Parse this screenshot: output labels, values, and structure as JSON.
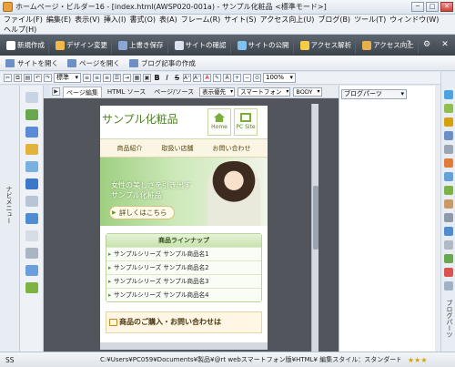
{
  "window": {
    "title": "ホームページ・ビルダー16 - [index.html(AWSP020-001a) - サンプル化粧品 <標準モード>]",
    "min": "─",
    "max": "□",
    "close": "✕"
  },
  "menu": {
    "row1": [
      "ファイル(F)",
      "編集(E)",
      "表示(V)",
      "挿入(I)",
      "書式(O)",
      "表(A)",
      "フレーム(R)",
      "サイト(S)",
      "アクセス向上(U)",
      "ブログ(B)",
      "ツール(T)",
      "ウィンドウ(W)"
    ],
    "row2": [
      "ヘルプ(H)"
    ]
  },
  "main_toolbar": [
    {
      "label": "新規作成",
      "color": "#ffffff"
    },
    {
      "label": "デザイン変更",
      "color": "#f2b84b"
    },
    {
      "label": "上書き保存",
      "color": "#8aa6d6"
    },
    {
      "label": "サイトの確認",
      "color": "#d9e2ee"
    },
    {
      "label": "サイトの公開",
      "color": "#7fc1ef"
    },
    {
      "label": "アクセス解析",
      "color": "#f4cc46"
    },
    {
      "label": "アクセス向上",
      "color": "#e8b04a"
    }
  ],
  "main_toolbar_right": [
    "?",
    "⚙",
    "✕"
  ],
  "sub_toolbar": [
    "サイトを開く",
    "ページを開く",
    "ブログ記事の作成"
  ],
  "format_toolbar": {
    "style_select": "標準",
    "zoom_select": "100%",
    "bold": "B",
    "italic": "I",
    "strike": "S"
  },
  "edit_tabs": {
    "tabs": [
      "ページ編集",
      "HTML ソース",
      "ページ/ソース"
    ],
    "view_select": "表示優先",
    "device_select": "スマートフォン",
    "body_select": "BODY"
  },
  "navigator_label": "ナビメニュー",
  "site": {
    "title": "サンプル化粧品",
    "home": "Home",
    "pc_site": "PC Site",
    "nav": [
      "商品紹介",
      "取扱い店舗",
      "お問い合わせ"
    ],
    "hero_line1": "女性の美しさを引き出す",
    "hero_line2": "サンプル化粧品",
    "hero_button": "詳しくはこちら",
    "lineup_title": "商品ラインナップ",
    "products": [
      "サンプルシリーズ サンプル商品名1",
      "サンプルシリーズ サンプル商品名2",
      "サンプルシリーズ サンプル商品名3",
      "サンプルシリーズ サンプル商品名4"
    ],
    "contact": "商品のご購入・お問い合わせは"
  },
  "right_panel": {
    "select": "ブログパーツ",
    "vertical_label": "ブログパーツ"
  },
  "status": {
    "mode": "SS",
    "path": "C:¥Users¥PC059¥Documents¥製品¥@rt webスマートフォン版¥HTML¥ 編集スタイル：スタンダード",
    "stars": "★★★"
  }
}
